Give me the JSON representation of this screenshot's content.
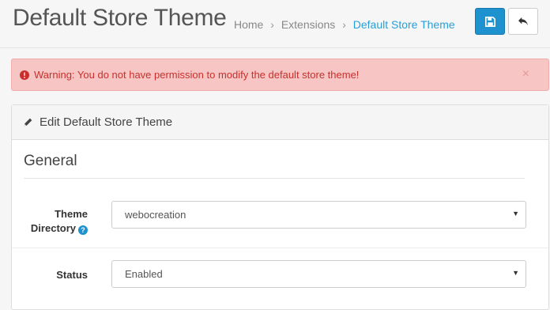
{
  "header": {
    "title": "Default Store Theme",
    "breadcrumb": [
      {
        "label": "Home"
      },
      {
        "label": "Extensions"
      },
      {
        "label": "Default Store Theme"
      }
    ],
    "breadcrumb_separator": "›"
  },
  "toolbar": {
    "save_icon": "save-icon",
    "back_icon": "reply-icon"
  },
  "alert": {
    "message": "Warning: You do not have permission to modify the default store theme!",
    "close_glyph": "×",
    "icon": "exclamation-circle-icon"
  },
  "panel": {
    "heading": "Edit Default Store Theme",
    "heading_icon": "pencil-icon",
    "legend": "General",
    "fields": {
      "theme_directory": {
        "label_line1": "Theme",
        "label_line2": "Directory",
        "help_glyph": "?",
        "value": "webocreation"
      },
      "status": {
        "label": "Status",
        "value": "Enabled"
      }
    }
  },
  "colors": {
    "primary": "#1e91cf",
    "link_active": "#2a9fd6",
    "alert_bg": "#f6c5c4",
    "alert_text": "#c9302c"
  }
}
